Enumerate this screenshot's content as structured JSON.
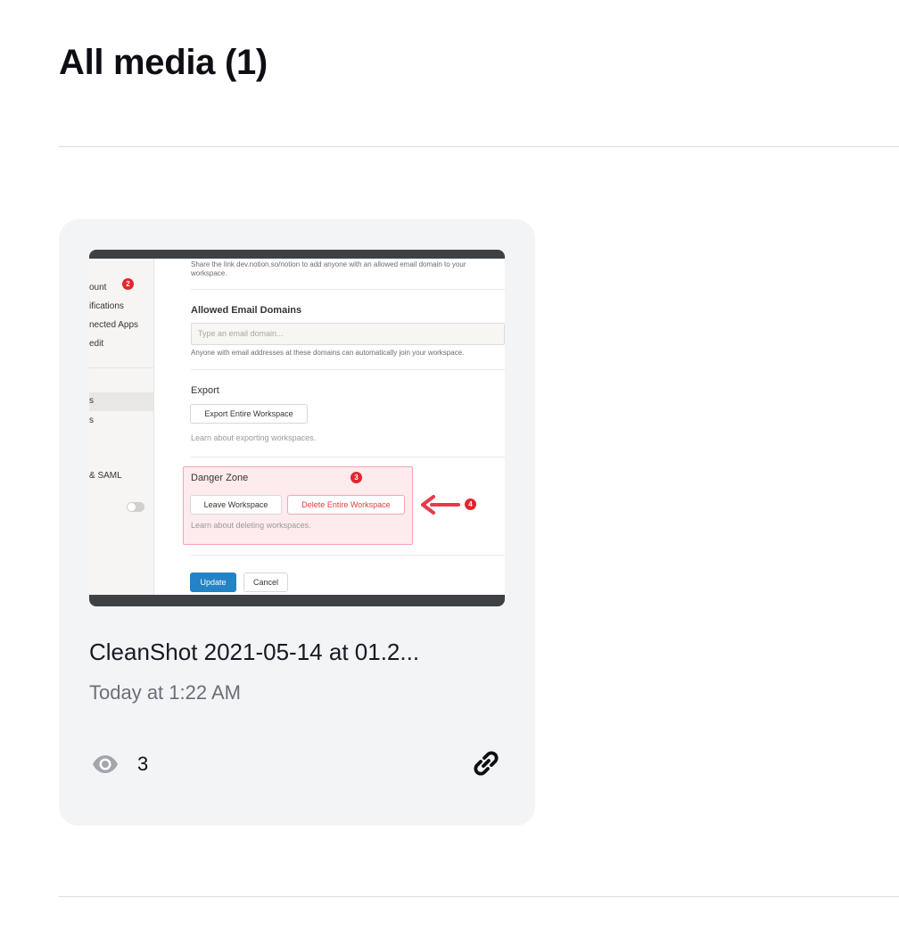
{
  "header": {
    "title": "All media (1)"
  },
  "media": [
    {
      "title": "CleanShot 2021-05-14 at 01.2...",
      "date": "Today at 1:22 AM",
      "views": "3",
      "view_icon": "eye-icon",
      "link_icon": "link-icon",
      "thumbnail": {
        "sidebar_items": [
          "ount",
          "ifications",
          "nected Apps",
          "edit",
          "s",
          "s",
          "& SAML"
        ],
        "sidebar_badge": "2",
        "share_text": "Share the link dev.notion.so/notion to add anyone with an allowed email domain to your",
        "share_text_2": "workspace.",
        "allowed_heading": "Allowed Email Domains",
        "email_placeholder": "Type an email domain...",
        "email_hint": "Anyone with email addresses at these domains can automatically join your workspace.",
        "export_heading": "Export",
        "export_button": "Export Entire Workspace",
        "export_help": "Learn about exporting workspaces.",
        "danger_heading": "Danger Zone",
        "danger_badge": "3",
        "leave_button": "Leave Workspace",
        "delete_button": "Delete Entire Workspace",
        "arrow_badge": "4",
        "delete_help": "Learn about deleting workspaces.",
        "update_button": "Update",
        "cancel_button": "Cancel"
      }
    }
  ]
}
